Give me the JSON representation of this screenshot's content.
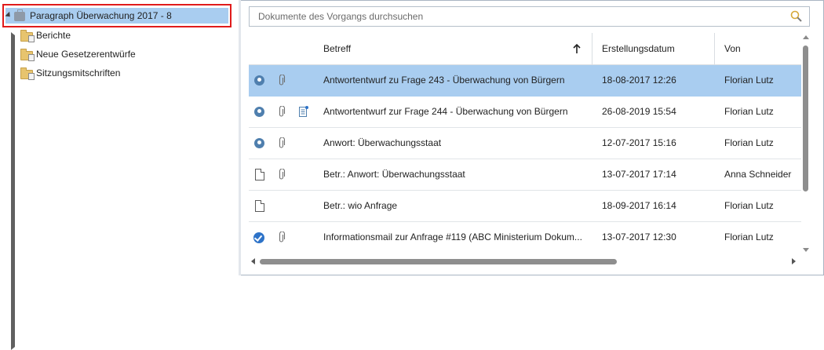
{
  "tree": {
    "root": {
      "label": "Paragraph Überwachung 2017 - 8",
      "expanded": true
    },
    "children": [
      {
        "label": "Berichte",
        "expandable": true
      },
      {
        "label": "Neue Gesetzerentwürfe",
        "expandable": false
      },
      {
        "label": "Sitzungsmitschriften",
        "expandable": true
      }
    ]
  },
  "search": {
    "placeholder": "Dokumente des Vorgangs durchsuchen",
    "icon": "search-icon"
  },
  "table": {
    "columns": {
      "subject": "Betreff",
      "date": "Erstellungsdatum",
      "from": "Von"
    },
    "sort": {
      "column": "subject",
      "direction": "ascending"
    },
    "rows": [
      {
        "type": "badge",
        "attachment": true,
        "note": false,
        "subject": "Antwortentwurf zu Frage 243 - Überwachung von Bürgern",
        "date": "18-08-2017 12:26",
        "from": "Florian Lutz",
        "selected": true
      },
      {
        "type": "badge",
        "attachment": true,
        "note": true,
        "subject": "Antwortentwurf zur Frage 244 - Überwachung von Bürgern",
        "date": "26-08-2019 15:54",
        "from": "Florian Lutz",
        "selected": false
      },
      {
        "type": "badge",
        "attachment": true,
        "note": false,
        "subject": "Anwort: Überwachungsstaat",
        "date": "12-07-2017 15:16",
        "from": "Florian Lutz",
        "selected": false
      },
      {
        "type": "document",
        "attachment": true,
        "note": false,
        "subject": "Betr.: Anwort: Überwachungsstaat",
        "date": "13-07-2017 17:14",
        "from": "Anna Schneider",
        "selected": false
      },
      {
        "type": "document",
        "attachment": false,
        "note": false,
        "subject": "Betr.: wio Anfrage",
        "date": "18-09-2017 16:14",
        "from": "Florian Lutz",
        "selected": false
      },
      {
        "type": "check",
        "attachment": true,
        "note": false,
        "subject": "Informationsmail zur Anfrage #119 (ABC Ministerium Dokum...",
        "date": "13-07-2017 12:30",
        "from": "Florian Lutz",
        "selected": false
      }
    ]
  },
  "colors": {
    "selection": "#a9cdf0",
    "highlight_border": "#e01b1b",
    "badge": "#4f7fae",
    "check": "#2e73c8"
  }
}
